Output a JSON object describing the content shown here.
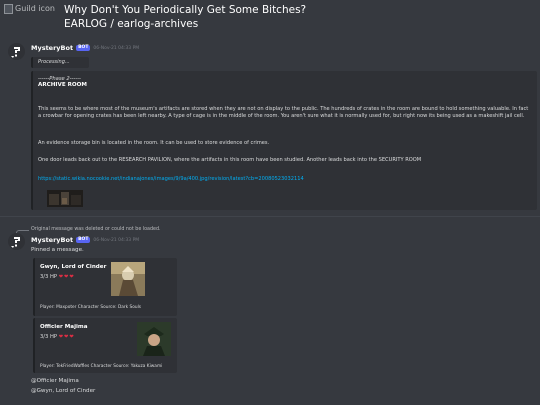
{
  "header": {
    "guild_icon_alt": "Guild icon",
    "title": "Why Don't You Periodically Get Some Bitches?",
    "channel_path": "EARLOG / earlog-archives"
  },
  "message1": {
    "author": "MysteryBot",
    "bot_tag": "BOT",
    "timestamp": "06-Nov-21 04:33 PM",
    "processing": "Processing...",
    "embed": {
      "phase": "------Phase 2------",
      "title": "ARCHIVE ROOM",
      "para1": "This seems to be where most of the museum's artifacts are stored when they are not on display to the public. The hundreds of crates in the room are bound to hold something valuable. In fact a crowbar for opening crates has been left nearby. A type of cage is in the middle of the room. You aren't sure what it is normally used for, but right now its being used as a makeshift jail cell.",
      "para2": "An evidence storage bin is located in the room. It can be used to store evidence of crimes.",
      "para3": "One door leads back out to the RESEARCH PAVILION, where the artifacts in this room have been studied. Another leads back into the SECURITY ROOM",
      "link": "https://static.wikia.nocookie.net/indianajones/images/9/9a/400.jpg/revision/latest?cb=20080523032114"
    }
  },
  "message2": {
    "reply_notice": "Original message was deleted or could not be loaded.",
    "author": "MysteryBot",
    "bot_tag": "BOT",
    "timestamp": "06-Nov-21 04:33 PM",
    "pinned_text": "Pinned a message.",
    "cards": [
      {
        "name": "Gwyn, Lord of Cinder",
        "hp_label": "3/3 HP",
        "hearts": "❤❤❤",
        "player_line": "Player: Maxpoter Character Source: Dark Souls"
      },
      {
        "name": "Officier Majima",
        "hp_label": "3/3 HP",
        "hearts": "❤❤❤",
        "player_line": "Player: TekFriedWaffles Character Source: Yakuza Kiwami"
      }
    ],
    "mentions": [
      "@Officier Majima",
      "@Gwyn, Lord of Cinder"
    ]
  },
  "colors": {
    "background": "#36393f",
    "embed_bg": "#2f3136",
    "bot_tag": "#5865f2",
    "link": "#00aff4",
    "heart": "#dd2e44"
  },
  "icons": {
    "avatar": "mystery-question-icon",
    "guild": "broken-image-icon"
  }
}
